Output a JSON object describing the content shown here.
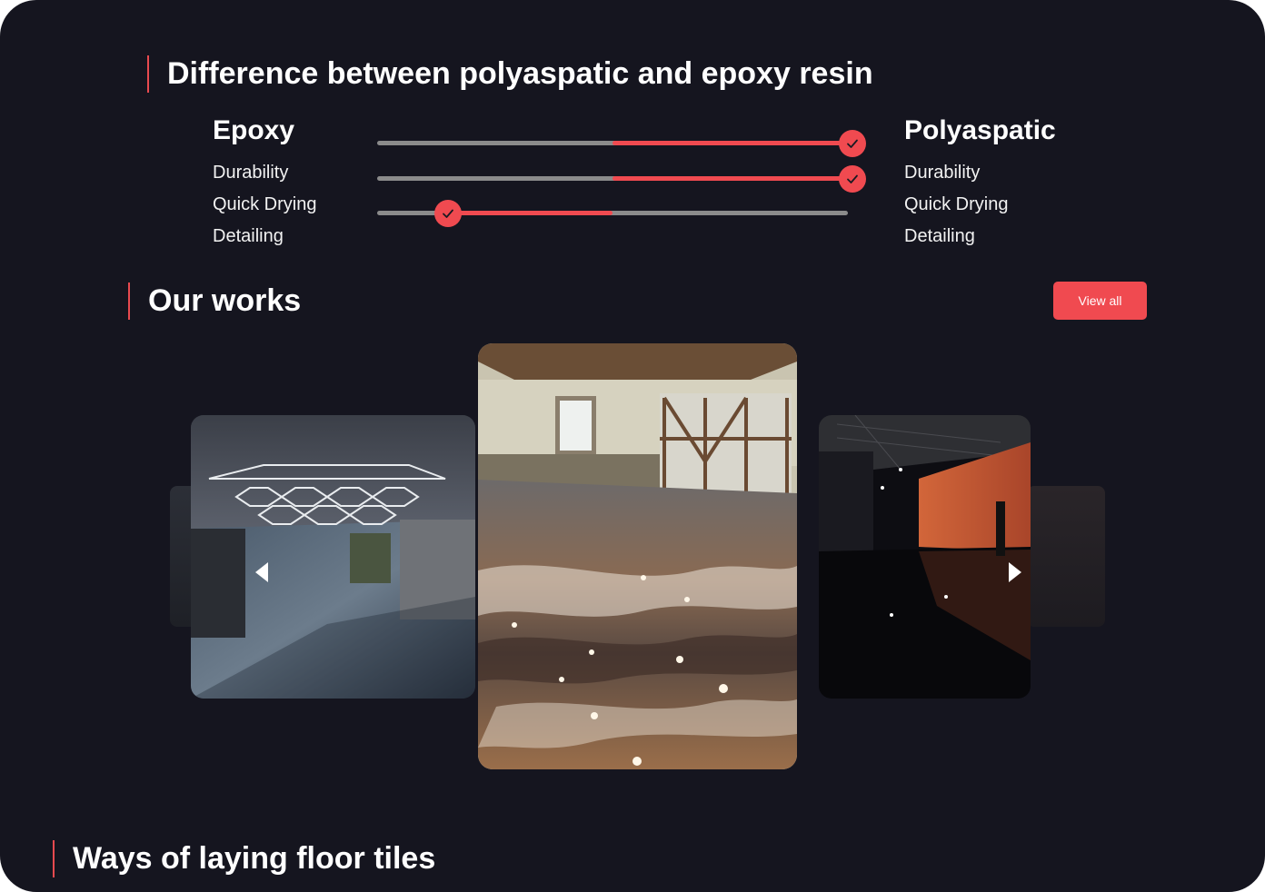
{
  "comparison": {
    "title": "Difference between polyaspatic and epoxy resin",
    "left": {
      "heading": "Epoxy",
      "items": [
        "Durability",
        "Quick Drying",
        "Detailing"
      ]
    },
    "right": {
      "heading": "Polyaspatic",
      "items": [
        "Durability",
        "Quick Drying",
        "Detailing"
      ]
    },
    "sliders": [
      {
        "criterion": "Durability",
        "value": 1.0
      },
      {
        "criterion": "Quick Drying",
        "value": 1.0
      },
      {
        "criterion": "Detailing",
        "value": 0.15
      }
    ]
  },
  "works": {
    "title": "Our works",
    "view_all_label": "View all",
    "prev_icon": "chevron-left-icon",
    "next_icon": "chevron-right-icon"
  },
  "next_section": {
    "title": "Ways of laying floor tiles"
  },
  "colors": {
    "background": "#15151f",
    "accent": "#f04a50",
    "track": "#8b8b8b"
  }
}
